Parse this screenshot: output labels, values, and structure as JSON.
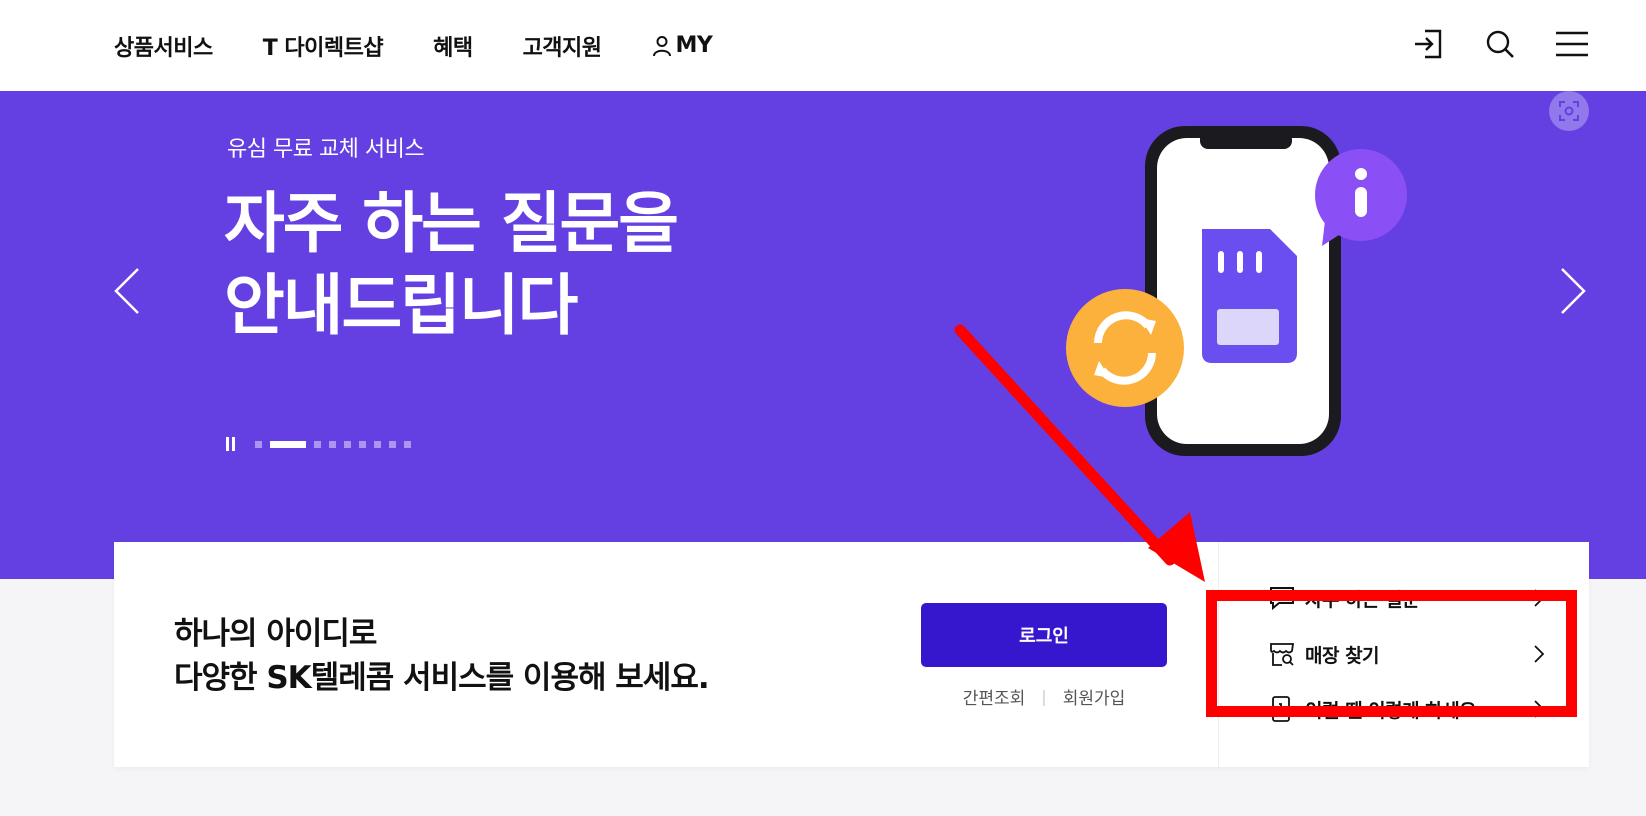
{
  "header": {
    "nav": [
      {
        "label": "상품서비스"
      },
      {
        "label": "T 다이렉트샵"
      },
      {
        "label": "혜택"
      },
      {
        "label": "고객지원"
      },
      {
        "label": "MY"
      }
    ],
    "icons": [
      "login-icon",
      "search-icon",
      "menu-icon"
    ]
  },
  "hero": {
    "subtitle": "유심 무료 교체 서비스",
    "title_line1": "자주 하는 질문을",
    "title_line2": "안내드립니다",
    "pager": {
      "total": 9,
      "active_index": 1
    },
    "colors": {
      "background": "#6440e3",
      "sim": "#6a4ef0",
      "refresh": "#fbb13c",
      "info": "#8a4ff5"
    }
  },
  "card": {
    "message_line1": "하나의 아이디로",
    "message_line2": "다양한 SK텔레콤 서비스를 이용해 보세요.",
    "login_button": "로그인",
    "links": [
      "간편조회",
      "회원가입"
    ],
    "separator": "|",
    "quick_links": [
      {
        "label": "자주 하는 질문",
        "icon": "chat-icon"
      },
      {
        "label": "매장 찾기",
        "icon": "store-search-icon"
      },
      {
        "label": "이럴 땐 이렇게 하세요",
        "icon": "phone-guide-icon"
      }
    ],
    "colors": {
      "login_button": "#3617ce"
    }
  },
  "annotation": {
    "color": "#ff0000"
  }
}
